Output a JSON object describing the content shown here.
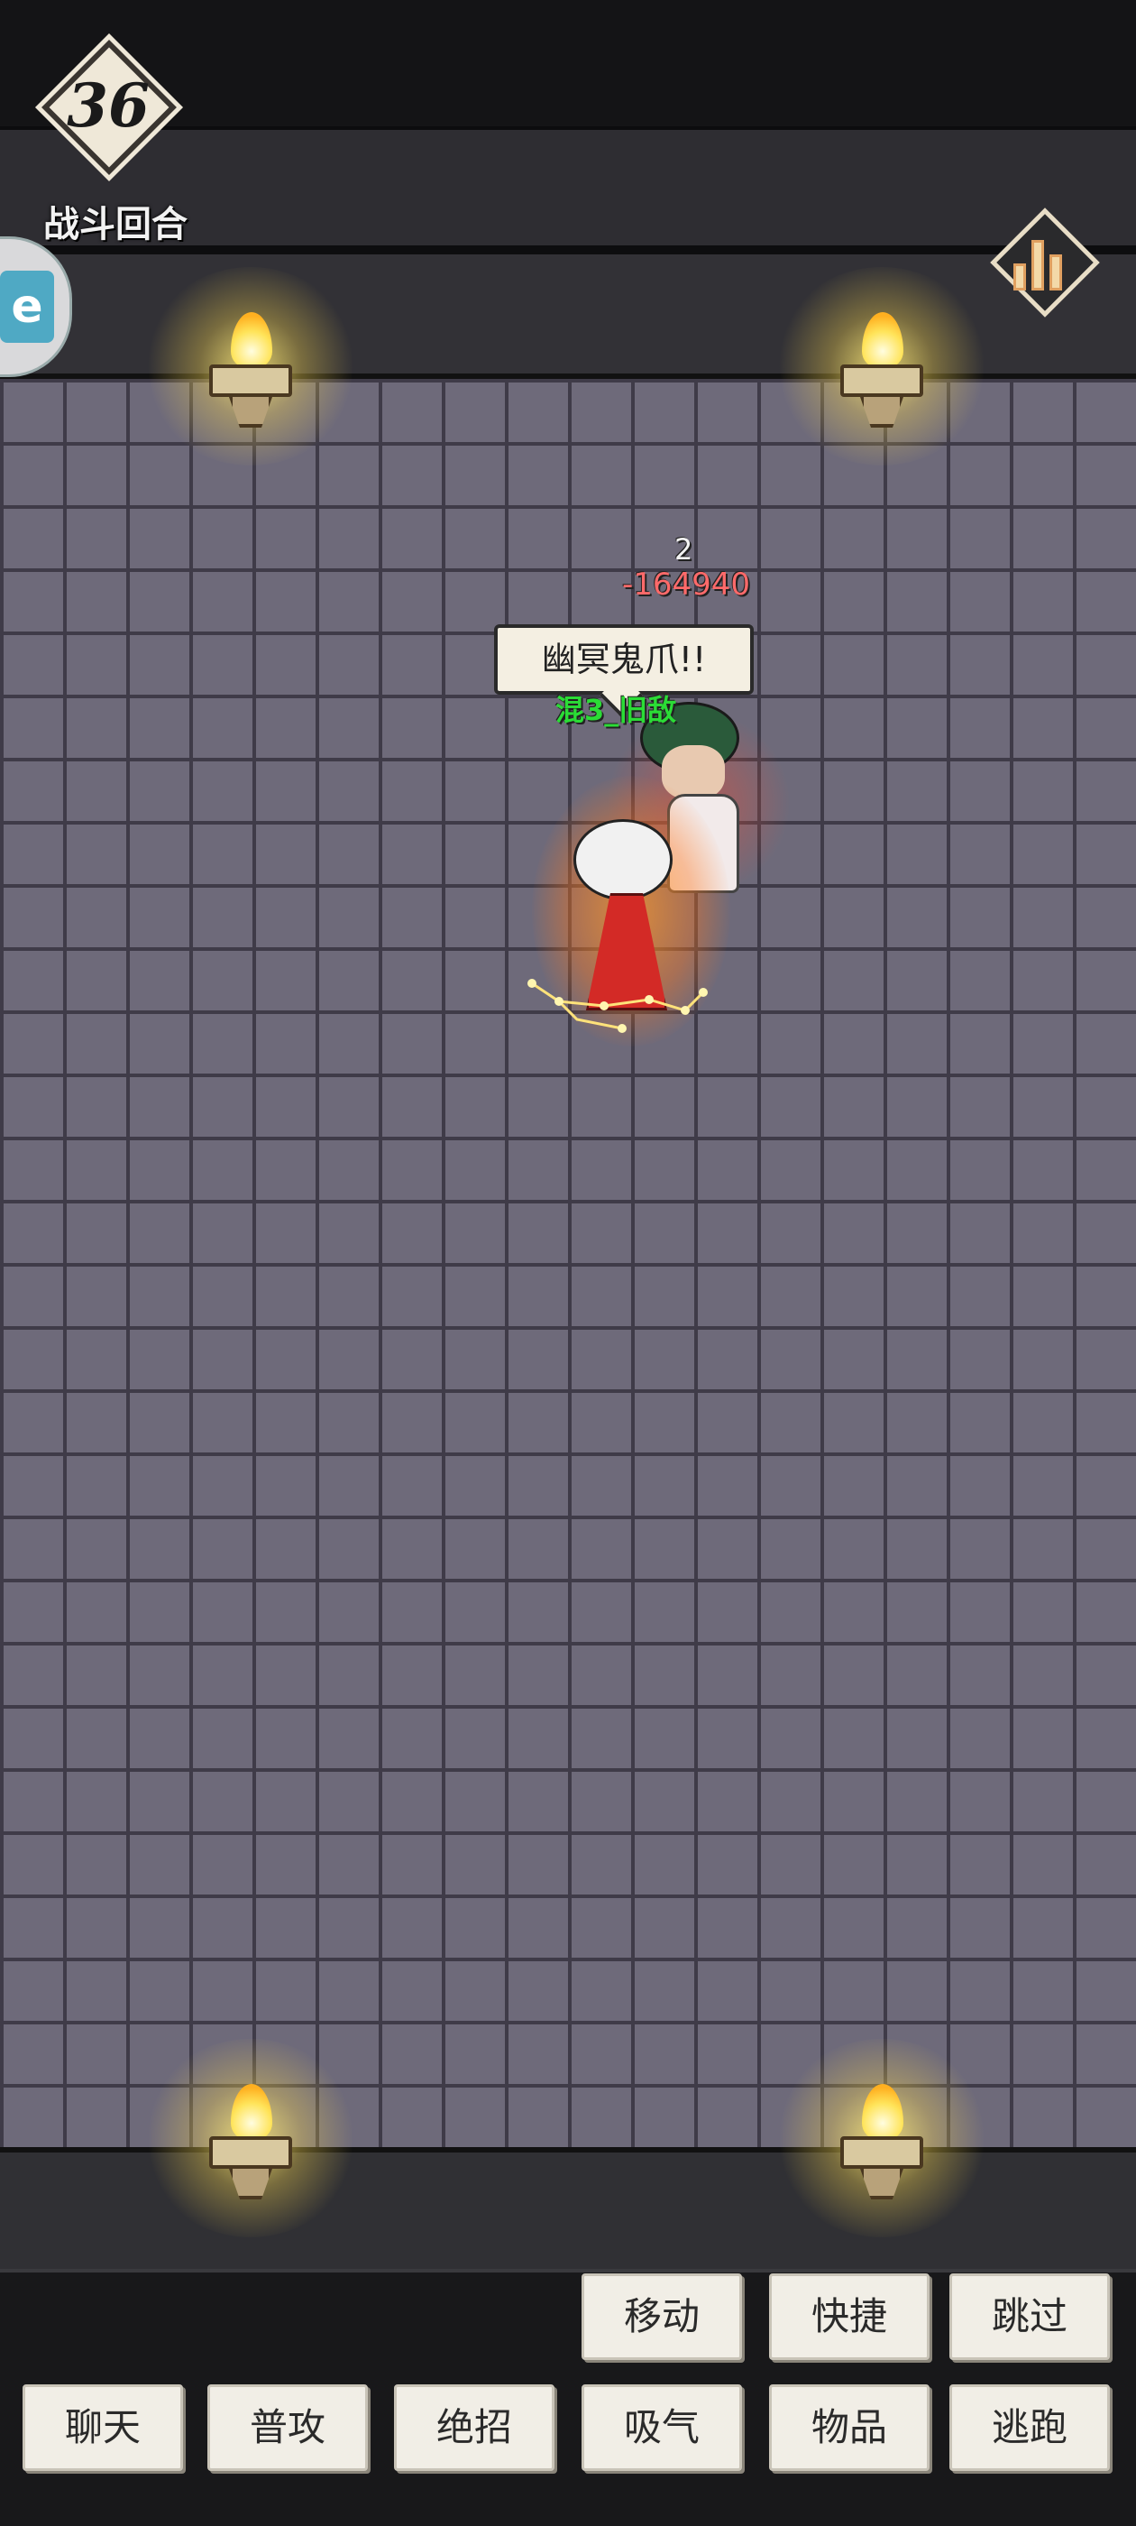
{
  "hud": {
    "round_number": "36",
    "round_label": "战斗回合",
    "stats_icon": "bar-chart-icon"
  },
  "combat": {
    "hit_count": "2",
    "damage": "-164940",
    "skill_callout": "幽冥鬼爪!!",
    "enemy_name": "混3_旧敌"
  },
  "actions": {
    "row1": [
      "移动",
      "快捷",
      "跳过"
    ],
    "row2": [
      "聊天",
      "普攻",
      "绝招",
      "吸气",
      "物品",
      "逃跑"
    ]
  },
  "colors": {
    "floor": "#6e6a7a",
    "damage_text": "#ff6a6a",
    "enemy_name_text": "#2bdc36",
    "button_bg": "#f1eee6"
  }
}
